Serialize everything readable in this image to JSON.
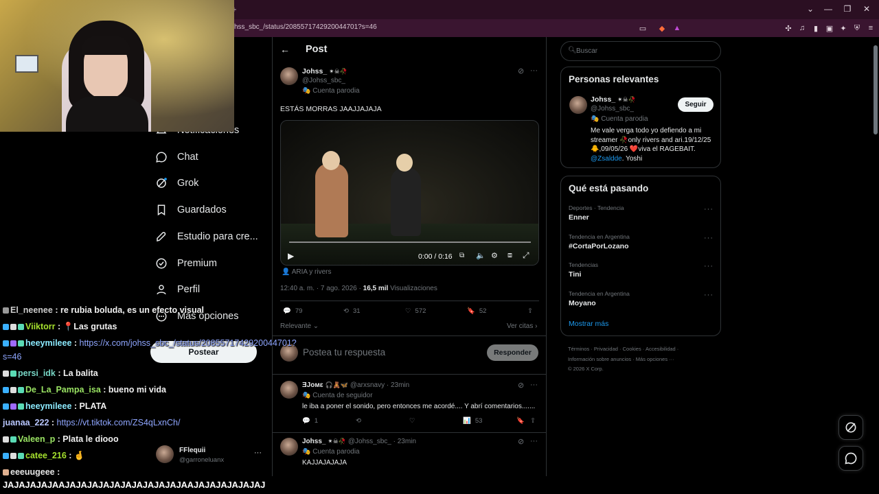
{
  "browser": {
    "url": "hss_sbc_/status/2085571742920044701?s=46",
    "tab_plus": "+",
    "win_min": "⌄",
    "win_minimize": "—",
    "win_restore": "❐",
    "win_close": "✕"
  },
  "nav": {
    "items": [
      {
        "label": "Notificaciones",
        "icon": "bell-icon"
      },
      {
        "label": "Chat",
        "icon": "chat-bubble-icon"
      },
      {
        "label": "Grok",
        "icon": "grok-icon"
      },
      {
        "label": "Guardados",
        "icon": "bookmark-icon"
      },
      {
        "label": "Estudio para cre...",
        "icon": "rocket-icon"
      },
      {
        "label": "Premium",
        "icon": "verified-badge-icon"
      },
      {
        "label": "Perfil",
        "icon": "person-icon"
      },
      {
        "label": "Más opciones",
        "icon": "more-circle-icon"
      }
    ],
    "post_button": "Postear",
    "account": {
      "name": "FFlequii",
      "handle": "@garroneluanx",
      "more": "···"
    }
  },
  "chat": [
    {
      "user": "El_neenee",
      "msg": " : re rubia boluda, es un efecto visual",
      "color": "#cccccc"
    },
    {
      "user": "Viiktorr",
      "msg": " : 📍Las grutas",
      "color": "#a6e22e"
    },
    {
      "user": "heeymileee",
      "msg": " : ",
      "link": "https://x.com/johss_sbc_/status/2085571742920044701?",
      "link2": "s=46",
      "color": "#8be9fd"
    },
    {
      "user": "persi_idk",
      "msg": " : La balita",
      "color": "#78d6c6"
    },
    {
      "user": "De_La_Pampa_isa",
      "msg": " : bueno mi vida",
      "color": "#9be564"
    },
    {
      "user": "heeymileee",
      "msg": " : PLATA",
      "color": "#8be9fd"
    },
    {
      "user": "juanaa_222",
      "msg": " : ",
      "link": "https://vt.tiktok.com/ZS4qLxnCh/",
      "color": "#b9c7ff"
    },
    {
      "user": "Valeen_p",
      "msg": " : Plata le diooo",
      "color": "#9be564"
    },
    {
      "user": "catee_216",
      "msg": " : 🤞",
      "color": "#a6e22e"
    },
    {
      "user": "eeeuugeee",
      "msg": " :",
      "color": "#e6e6e6"
    }
  ],
  "chat_big": "JAJAJAJAJAAJAJAJAJAJAJAJAJAJAJAJAAJAJAJAJAJAJAJ",
  "post": {
    "header": "Post",
    "author_name": "Johss_",
    "author_handle": "@Johss_sbc_",
    "parody_label": "Cuenta parodia",
    "text": "ESTÁS MORRAS JAAJJAJAJA",
    "video_time": "0:00 / 0:16",
    "video_tag": "ARIA y rivers",
    "timestamp": "12:40 a. m. · 7 ago. 2026 · ",
    "views_count": "16,5 mil",
    "views_label": " Visualizaciones",
    "replies": "79",
    "reposts": "31",
    "likes": "572",
    "bookmarks": "52",
    "sort": "Relevante",
    "quotes": "Ver citas",
    "reply_placeholder": "Postea tu respuesta",
    "reply_button": "Responder"
  },
  "replies": [
    {
      "name": "ƎJoмɛ",
      "handle": "@arxsnavy · 23min",
      "label": "Cuenta de seguidor",
      "text": "le iba a poner el sonido, pero entonces me acordé.... Y abrí comentarios.......",
      "replies": "1",
      "views": "53"
    },
    {
      "name": "Johss_",
      "handle": "@Johss_sbc_ · 23min",
      "label": "Cuenta parodia",
      "text": "KAJJAJAJAJA"
    }
  ],
  "sidebar": {
    "search_placeholder": "Buscar",
    "relevant_title": "Personas relevantes",
    "relevant": {
      "name": "Johss_",
      "handle": "@Johss_sbc_",
      "label": "Cuenta parodia",
      "follow": "Seguir",
      "bio": "Me vale verga todo yo defiendo a mi streamer 🥀only rivers and ari.19/12/25🐥,09/05/26 ❤️viva el RAGEBAIT. ",
      "bio_mention": "@Zsaldde",
      "bio_end": ". Yoshi"
    },
    "trending_title": "Qué está pasando",
    "trends": [
      {
        "cat": "Deportes · Tendencia",
        "name": "Enner"
      },
      {
        "cat": "Tendencia en Argentina",
        "name": "#CortaPorLozano"
      },
      {
        "cat": "Tendencias",
        "name": "Tini"
      },
      {
        "cat": "Tendencia en Argentina",
        "name": "Moyano"
      }
    ],
    "show_more": "Mostrar más",
    "footer_line1": "Términos · Privacidad · Cookies · Accesibilidad ·",
    "footer_line2": "Información sobre anuncios · Más opciones ···",
    "footer_line3": "© 2026 X Corp."
  },
  "colors": {
    "accent": "#1d9bf0",
    "link": "#8fa6ff",
    "muted": "#71767b",
    "border": "#2f3336"
  }
}
